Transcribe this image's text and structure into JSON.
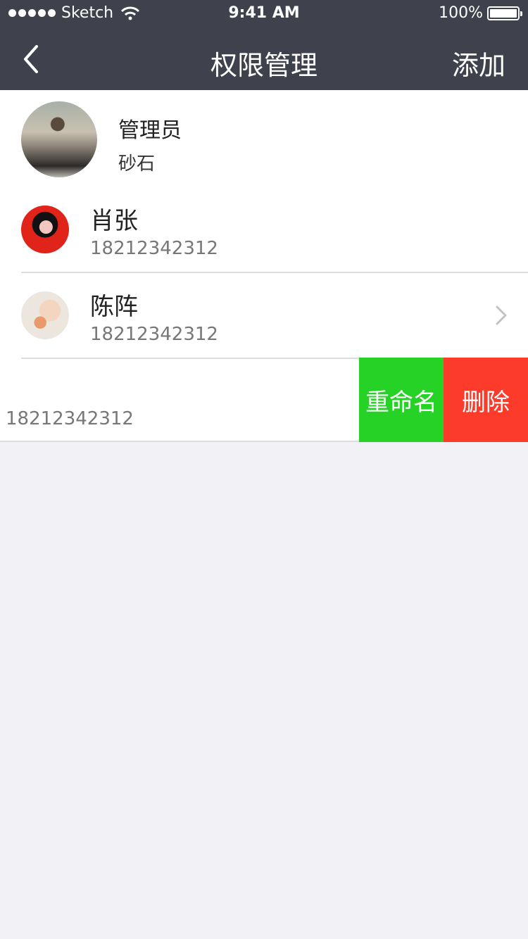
{
  "status_bar": {
    "carrier": "Sketch",
    "time": "9:41 AM",
    "battery": "100%"
  },
  "nav": {
    "title": "权限管理",
    "add_label": "添加"
  },
  "admin": {
    "role": "管理员",
    "name": "砂石"
  },
  "users": [
    {
      "name": "肖张",
      "phone": "18212342312"
    },
    {
      "name": "陈阵",
      "phone": "18212342312"
    },
    {
      "name": "",
      "phone": "18212342312"
    }
  ],
  "swipe_actions": {
    "rename_label": "重命名",
    "delete_label": "删除"
  },
  "colors": {
    "header_bg": "#3f414c",
    "rename_bg": "#27d227",
    "delete_bg": "#fd3b2b",
    "page_bg": "#f2f2f6"
  }
}
